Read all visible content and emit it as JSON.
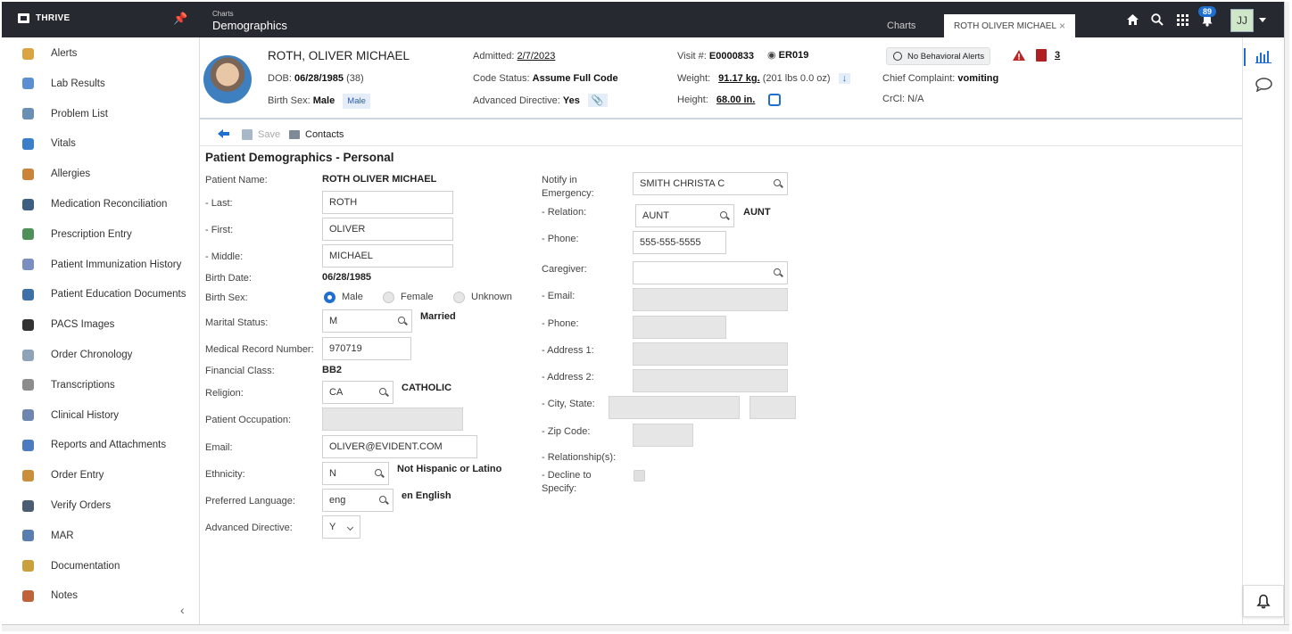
{
  "topbar": {
    "brand": "THRIVE",
    "crumb_small": "Charts",
    "crumb_title": "Demographics",
    "tab_charts": "Charts",
    "tab_patient": "ROTH OLIVER MICHAEL",
    "tab_close": "×",
    "notification_count": "89",
    "user_initials": "JJ"
  },
  "sidebar": {
    "items": [
      {
        "label": "Alerts",
        "color": "#d9a441"
      },
      {
        "label": "Lab Results",
        "color": "#5b8fd1"
      },
      {
        "label": "Problem List",
        "color": "#6a8fb5"
      },
      {
        "label": "Vitals",
        "color": "#3b7ec9"
      },
      {
        "label": "Allergies",
        "color": "#c9833b"
      },
      {
        "label": "Medication Reconciliation",
        "color": "#3d5f82"
      },
      {
        "label": "Prescription Entry",
        "color": "#4f8f5a"
      },
      {
        "label": "Patient Immunization History",
        "color": "#7a8fc0"
      },
      {
        "label": "Patient Education Documents",
        "color": "#3d6fa8"
      },
      {
        "label": "PACS Images",
        "color": "#333333"
      },
      {
        "label": "Order Chronology",
        "color": "#8fa3b8"
      },
      {
        "label": "Transcriptions",
        "color": "#8c8c8c"
      },
      {
        "label": "Clinical History",
        "color": "#6f87b0"
      },
      {
        "label": "Reports and Attachments",
        "color": "#4d7bbf"
      },
      {
        "label": "Order Entry",
        "color": "#c98f3b"
      },
      {
        "label": "Verify Orders",
        "color": "#4a5d73"
      },
      {
        "label": "MAR",
        "color": "#5a7db0"
      },
      {
        "label": "Documentation",
        "color": "#c9a03b"
      },
      {
        "label": "Notes",
        "color": "#c0633b"
      }
    ],
    "collapse": "‹"
  },
  "patient": {
    "last_name": "ROTH,",
    "first_middle": " OLIVER MICHAEL",
    "dob_label": "DOB:",
    "dob": "06/28/1985",
    "age": "(38)",
    "birth_sex_label": "Birth Sex:",
    "birth_sex": "Male",
    "birth_sex_chip": "Male",
    "admitted_label": "Admitted:",
    "admitted": "2/7/2023",
    "code_status_label": "Code Status:",
    "code_status": "Assume Full Code",
    "adv_dir_label": "Advanced Directive:",
    "adv_dir": "Yes",
    "visit_label": "Visit #:",
    "visit": "E0000833",
    "location": "ER019",
    "weight_label": "Weight:",
    "weight": "91.17 kg.",
    "weight_lbs": "(201 lbs 0.0 oz)",
    "height_label": "Height:",
    "height": "68.00 in.",
    "behavioral": "No Behavioral Alerts",
    "alert_count": "3",
    "complaint_label": "Chief Complaint:",
    "complaint": "vomiting",
    "crcl_label": "CrCl:",
    "crcl": "N/A"
  },
  "toolbar": {
    "save": "Save",
    "contacts": "Contacts"
  },
  "form": {
    "title": "Patient Demographics - Personal",
    "patient_name_label": "Patient Name:",
    "patient_name": "ROTH OLIVER MICHAEL",
    "last_label": "- Last:",
    "last": "ROTH",
    "first_label": "- First:",
    "first": "OLIVER",
    "middle_label": "- Middle:",
    "middle": "MICHAEL",
    "birth_date_label": "Birth Date:",
    "birth_date": "06/28/1985",
    "birth_sex_label": "Birth Sex:",
    "sex_options": [
      "Male",
      "Female",
      "Unknown"
    ],
    "marital_label": "Marital Status:",
    "marital_code": "M",
    "marital_desc": "Married",
    "mrn_label": "Medical Record Number:",
    "mrn": "970719",
    "fin_class_label": "Financial Class:",
    "fin_class": "BB2",
    "religion_label": "Religion:",
    "religion_code": "CA",
    "religion_desc": "CATHOLIC",
    "occupation_label": "Patient Occupation:",
    "email_label": "Email:",
    "email": "OLIVER@EVIDENT.COM",
    "ethnicity_label": "Ethnicity:",
    "ethnicity_code": "N",
    "ethnicity_desc": "Not Hispanic or Latino",
    "language_label": "Preferred Language:",
    "language_code": "eng",
    "language_desc": "en English",
    "adv_dir_label": "Advanced Directive:",
    "adv_dir": "Y",
    "notify_label_1": "Notify in",
    "notify_label_2": "Emergency:",
    "notify": "SMITH CHRISTA C",
    "relation_label": "- Relation:",
    "relation_code": "AUNT",
    "relation_desc": "AUNT",
    "phone_label": "- Phone:",
    "phone": "555-555-5555",
    "caregiver_label": "Caregiver:",
    "cg_email_label": "- Email:",
    "cg_phone_label": "- Phone:",
    "addr1_label": "- Address 1:",
    "addr2_label": "- Address 2:",
    "city_label": "- City, State:",
    "zip_label": "- Zip Code:",
    "relationships_label": "- Relationship(s):",
    "decline_label_1": "- Decline to",
    "decline_label_2": "Specify:"
  },
  "colors": {
    "topbar": "#262a30",
    "accent": "#1f6fd1",
    "alert_red": "#b02020"
  }
}
